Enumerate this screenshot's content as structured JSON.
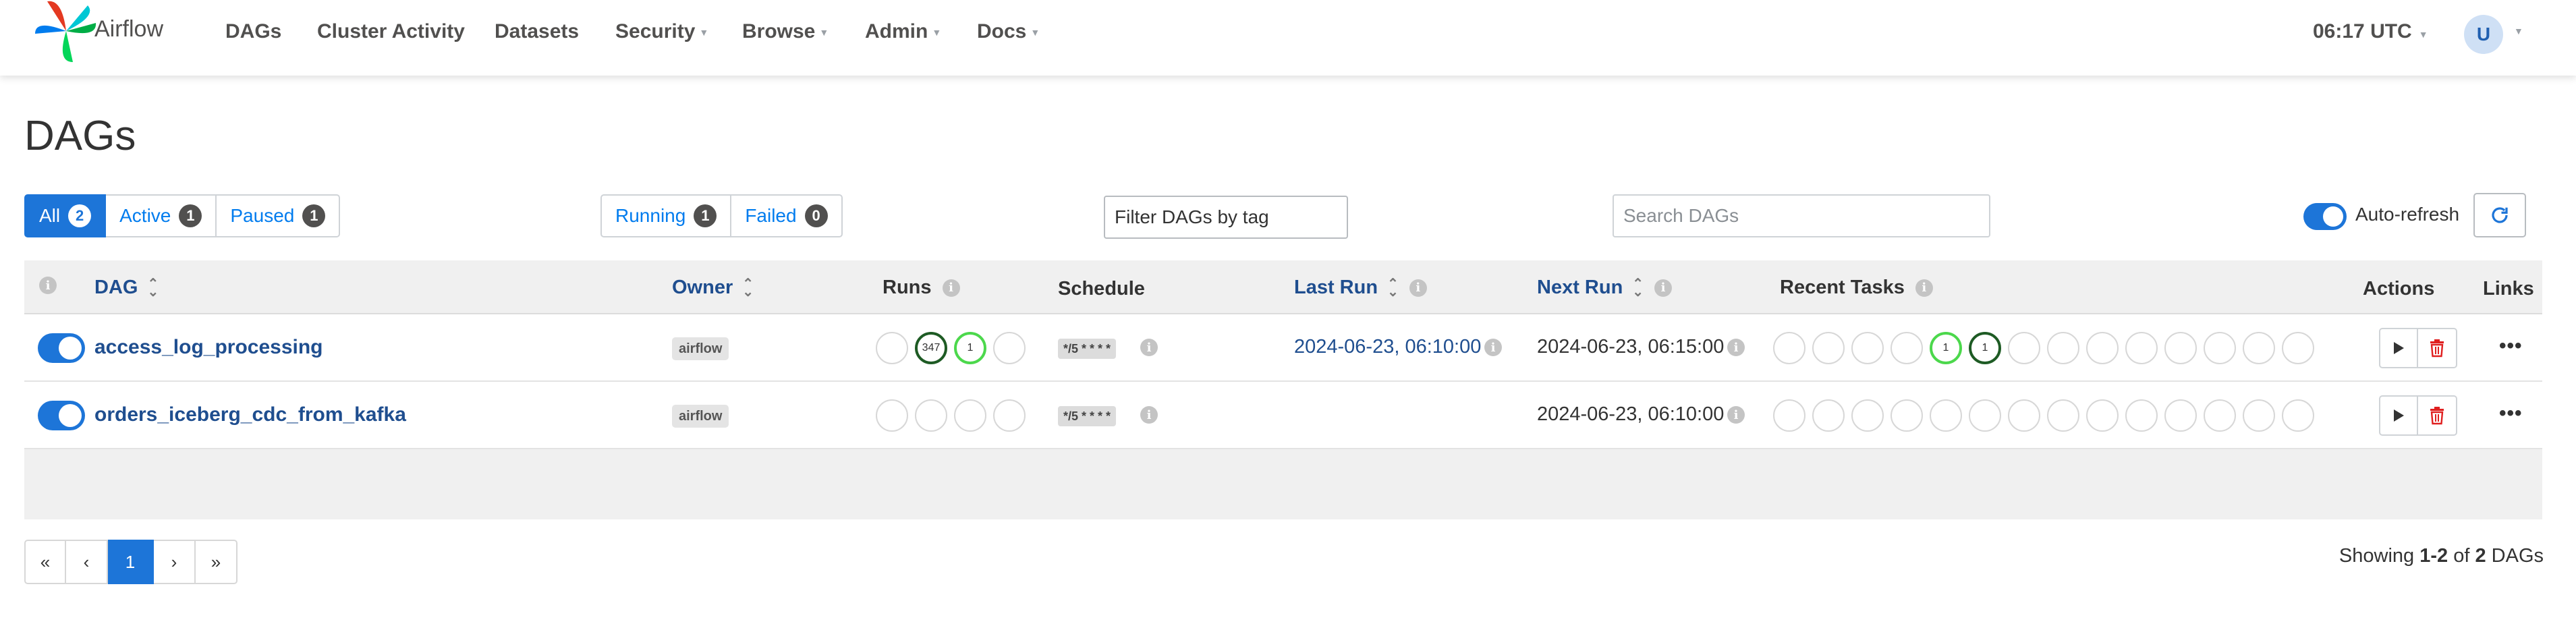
{
  "nav": {
    "brand": "Airflow",
    "items": [
      "DAGs",
      "Cluster Activity",
      "Datasets",
      "Security",
      "Browse",
      "Admin",
      "Docs"
    ],
    "clock": "06:17 UTC",
    "avatar": "U"
  },
  "page": {
    "title": "DAGs"
  },
  "filters": {
    "status": [
      {
        "label": "All",
        "count": "2",
        "active": true
      },
      {
        "label": "Active",
        "count": "1",
        "active": false
      },
      {
        "label": "Paused",
        "count": "1",
        "active": false
      }
    ],
    "state": [
      {
        "label": "Running",
        "count": "1"
      },
      {
        "label": "Failed",
        "count": "0"
      }
    ],
    "tag_placeholder": "Filter DAGs by tag",
    "search_placeholder": "Search DAGs",
    "auto_refresh_label": "Auto-refresh",
    "auto_refresh_on": true
  },
  "table": {
    "headers": {
      "dag": "DAG",
      "owner": "Owner",
      "runs": "Runs",
      "schedule": "Schedule",
      "last_run": "Last Run",
      "next_run": "Next Run",
      "recent_tasks": "Recent Tasks",
      "actions": "Actions",
      "links": "Links"
    },
    "rows": [
      {
        "dag_id": "access_log_processing",
        "owner": "airflow",
        "runs": [
          {
            "state": "none",
            "count": ""
          },
          {
            "state": "success",
            "count": "347"
          },
          {
            "state": "running",
            "count": "1"
          },
          {
            "state": "none",
            "count": ""
          }
        ],
        "schedule": "*/5 * * * *",
        "last_run": "2024-06-23, 06:10:00",
        "next_run": "2024-06-23, 06:15:00",
        "recent_tasks": [
          "",
          "",
          "",
          "",
          "1",
          "1",
          "",
          "",
          "",
          "",
          "",
          "",
          "",
          ""
        ],
        "recent_task_states": [
          "none",
          "none",
          "none",
          "none",
          "running",
          "success",
          "none",
          "none",
          "none",
          "none",
          "none",
          "none",
          "none",
          "none"
        ]
      },
      {
        "dag_id": "orders_iceberg_cdc_from_kafka",
        "owner": "airflow",
        "runs": [
          {
            "state": "none",
            "count": ""
          },
          {
            "state": "none",
            "count": ""
          },
          {
            "state": "none",
            "count": ""
          },
          {
            "state": "none",
            "count": ""
          }
        ],
        "schedule": "*/5 * * * *",
        "last_run": "",
        "next_run": "2024-06-23, 06:10:00",
        "recent_tasks": [
          "",
          "",
          "",
          "",
          "",
          "",
          "",
          "",
          "",
          "",
          "",
          "",
          "",
          ""
        ],
        "recent_task_states": [
          "none",
          "none",
          "none",
          "none",
          "none",
          "none",
          "none",
          "none",
          "none",
          "none",
          "none",
          "none",
          "none",
          "none"
        ]
      }
    ],
    "more_icon": "ellipsis-icon"
  },
  "pagination": {
    "first": "«",
    "prev": "‹",
    "current": "1",
    "next": "›",
    "last": "»"
  },
  "summary": {
    "prefix": "Showing",
    "range": "1-2",
    "of": "of",
    "total": "2",
    "suffix": "DAGs"
  },
  "colors": {
    "primary": "#1d75d8",
    "link": "#1f4e8f",
    "success": "#1e5b24",
    "running": "#4cd84c",
    "delete": "#e02020"
  }
}
